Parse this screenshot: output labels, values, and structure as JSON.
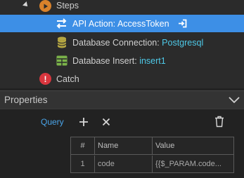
{
  "tree": {
    "steps_label": "Steps",
    "api_action": {
      "prefix": "API Action: ",
      "name": "AccessToken"
    },
    "db_connection": {
      "prefix": "Database Connection: ",
      "name": "Postgresql"
    },
    "db_insert": {
      "prefix": "Database Insert: ",
      "name": "insert1"
    },
    "catch_label": "Catch"
  },
  "properties": {
    "title": "Properties",
    "query_label": "Query",
    "table": {
      "headers": [
        "#",
        "Name",
        "Value"
      ],
      "rows": [
        {
          "num": "1",
          "name": "code",
          "value": "{{$_PARAM.code..."
        }
      ]
    }
  },
  "colors": {
    "selected_row": "#3d8fe6",
    "highlight_text": "#4ec9e8",
    "query_blue": "#4aa4e8",
    "steps_icon": "#d9822b",
    "db_icon": "#b5a642",
    "insert_icon": "#7bb34a",
    "catch_icon": "#d9363e"
  },
  "icons": {
    "steps": "play-circle-icon",
    "api": "exchange-arrows-icon",
    "api_suffix": "sign-in-icon",
    "db": "database-icon",
    "insert": "table-icon",
    "catch": "error-icon",
    "collapse": "chevron-down-icon",
    "add": "plus-icon",
    "remove": "close-icon",
    "delete": "trash-icon"
  }
}
